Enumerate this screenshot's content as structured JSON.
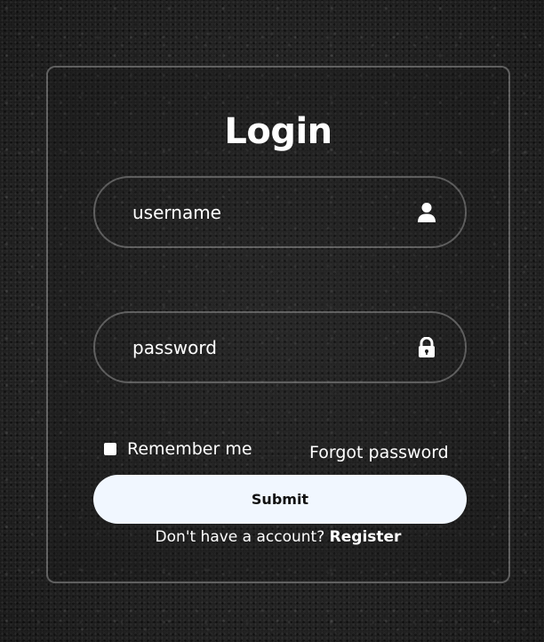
{
  "form": {
    "title": "Login",
    "username": {
      "placeholder": "username",
      "value": "",
      "icon": "user-icon"
    },
    "password": {
      "placeholder": "password",
      "value": "",
      "icon": "lock-icon"
    },
    "remember_label": "Remember me",
    "remember_checked": false,
    "forgot_label": "Forgot password",
    "submit_label": "Submit",
    "register_prompt": "Don't have a account? ",
    "register_label": "Register"
  },
  "colors": {
    "text": "#ffffff",
    "button_bg": "#f1f7ff",
    "button_text": "#111111"
  }
}
